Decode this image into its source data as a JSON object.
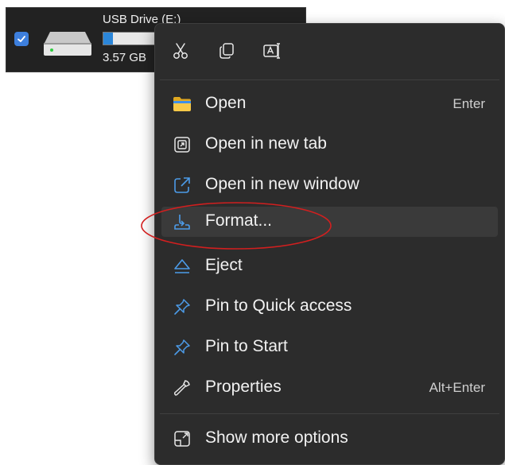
{
  "drive": {
    "name": "USB Drive (E:)",
    "space_text": "3.57 GB",
    "usage_fraction": 0.16,
    "checked": true
  },
  "toolbar": {
    "buttons": [
      {
        "icon": "cut-icon"
      },
      {
        "icon": "copy-icon"
      },
      {
        "icon": "rename-icon"
      }
    ]
  },
  "menu": {
    "items": [
      {
        "label": "Open",
        "shortcut": "Enter",
        "icon": "folder-icon"
      },
      {
        "label": "Open in new tab",
        "shortcut": "",
        "icon": "new-tab-icon"
      },
      {
        "label": "Open in new window",
        "shortcut": "",
        "icon": "new-window-icon"
      },
      {
        "label": "Format...",
        "shortcut": "",
        "icon": "format-icon",
        "highlighted": true
      },
      {
        "label": "Eject",
        "shortcut": "",
        "icon": "eject-icon"
      },
      {
        "label": "Pin to Quick access",
        "shortcut": "",
        "icon": "pin-icon"
      },
      {
        "label": "Pin to Start",
        "shortcut": "",
        "icon": "pin-icon"
      },
      {
        "label": "Properties",
        "shortcut": "Alt+Enter",
        "icon": "wrench-icon"
      },
      {
        "label": "Show more options",
        "shortcut": "",
        "icon": "more-options-icon"
      }
    ]
  },
  "colors": {
    "menu_background": "#2c2c2c",
    "accent_blue": "#4c9be8",
    "highlight_background": "#3a3a3a",
    "annotation_red": "#d21f1f"
  }
}
